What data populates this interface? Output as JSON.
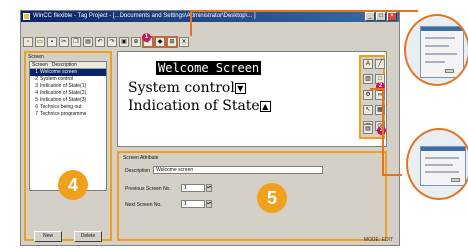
{
  "window": {
    "title": "WinCC flexible - Tag Project - [...Documents and Settings\\Administrator\\Desktop\\... ]",
    "min": "_",
    "max": "□",
    "close": "×"
  },
  "toolbar_icons": [
    "new-icon",
    "open-icon",
    "save-icon",
    "cut-icon",
    "copy-icon",
    "paste-icon",
    "undo-icon",
    "redo-icon",
    "screen-icon",
    "zoom-icon",
    "text-tool-icon",
    "symbol-tool-icon",
    "insert-icon",
    "delete-icon"
  ],
  "left_panel": {
    "caption": "Screen",
    "columns": [
      "Screen",
      "Description"
    ],
    "rows": [
      {
        "num": "1",
        "desc": "Welcome screen"
      },
      {
        "num": "2",
        "desc": "System control"
      },
      {
        "num": "3",
        "desc": "Indication of State(1)"
      },
      {
        "num": "4",
        "desc": "Indication of State(2)"
      },
      {
        "num": "5",
        "desc": "Indication of State(3)"
      },
      {
        "num": "6",
        "desc": "Technics being out"
      },
      {
        "num": "7",
        "desc": "Technics programme"
      }
    ],
    "new_button": "New",
    "delete_button": "Delete",
    "badge": "4"
  },
  "screen": {
    "line1": "Welcome Screen",
    "line2": "System control",
    "line3": "Indication of State",
    "sym2": "▼",
    "sym3": "▲"
  },
  "badges": {
    "toolbar": "1",
    "tools": "2",
    "tools_bottom": "3"
  },
  "attributes": {
    "caption": "Screen Attribute",
    "description_label": "Description",
    "description_value": "Welcome screen",
    "prev_label": "Previous Screen No.",
    "prev_value": "1",
    "next_label": "Next Screen No.",
    "next_value": "1",
    "badge": "5"
  },
  "status": "MODE: EDIT",
  "colors": {
    "accent": "#f0a01a",
    "connector": "#e8731e",
    "badge": "#c2185b"
  }
}
